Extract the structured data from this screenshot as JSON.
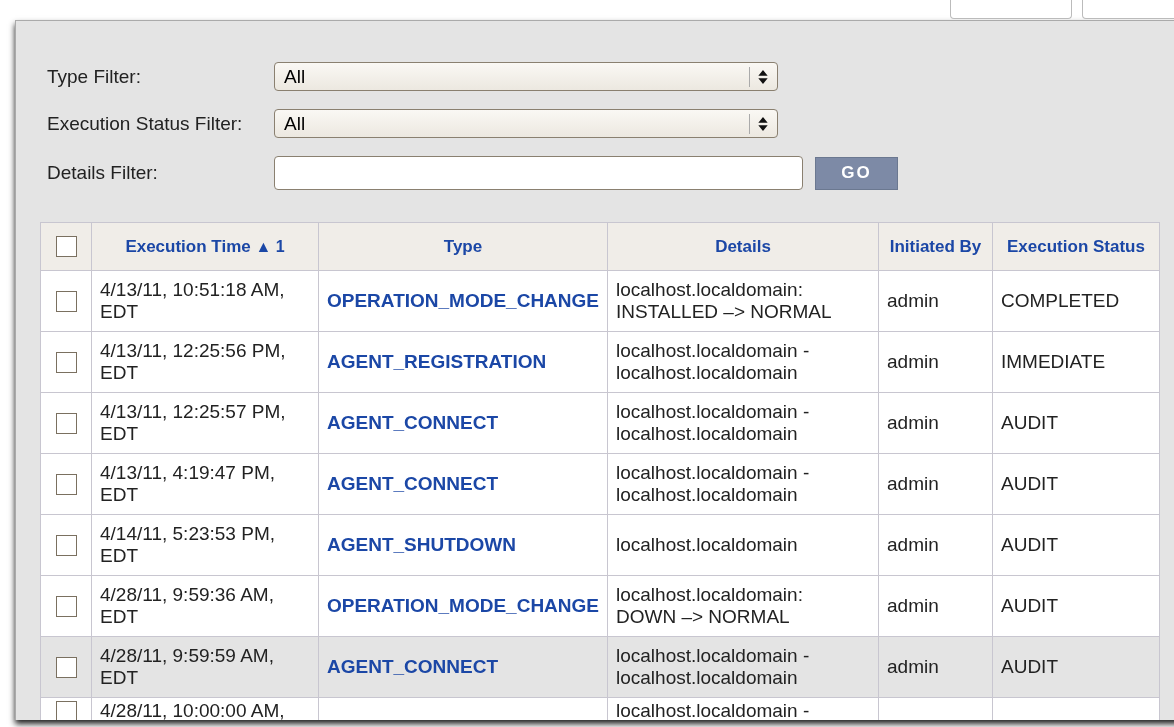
{
  "filters": [
    {
      "kind": "select",
      "label": "Type Filter:",
      "value": "All"
    },
    {
      "kind": "select",
      "label": "Execution Status Filter:",
      "value": "All"
    },
    {
      "kind": "text",
      "label": "Details Filter:",
      "button": "GO"
    }
  ],
  "table": {
    "select_all": {
      "checked": false
    },
    "columns": [
      {
        "label": "Execution Time",
        "sort": "▲ 1"
      },
      {
        "label": "Type"
      },
      {
        "label": "Details"
      },
      {
        "label": "Initiated By"
      },
      {
        "label": "Execution Status"
      }
    ],
    "rows": [
      {
        "checked": false,
        "selected": false,
        "time": "4/13/11, 10:51:18 AM, EDT",
        "type": "OPERATION_MODE_CHANGE",
        "details": "localhost.localdomain: INSTALLED –> NORMAL",
        "initiated_by": "admin",
        "status": "COMPLETED"
      },
      {
        "checked": false,
        "selected": false,
        "time": "4/13/11, 12:25:56 PM, EDT",
        "type": "AGENT_REGISTRATION",
        "details": "localhost.localdomain - localhost.localdomain",
        "initiated_by": "admin",
        "status": "IMMEDIATE"
      },
      {
        "checked": false,
        "selected": false,
        "time": "4/13/11, 12:25:57 PM, EDT",
        "type": "AGENT_CONNECT",
        "details": "localhost.localdomain - localhost.localdomain",
        "initiated_by": "admin",
        "status": "AUDIT"
      },
      {
        "checked": false,
        "selected": false,
        "time": "4/13/11, 4:19:47 PM, EDT",
        "type": "AGENT_CONNECT",
        "details": "localhost.localdomain - localhost.localdomain",
        "initiated_by": "admin",
        "status": "AUDIT"
      },
      {
        "checked": false,
        "selected": false,
        "time": "4/14/11, 5:23:53 PM, EDT",
        "type": "AGENT_SHUTDOWN",
        "details": "localhost.localdomain",
        "initiated_by": "admin",
        "status": "AUDIT"
      },
      {
        "checked": false,
        "selected": false,
        "time": "4/28/11, 9:59:36 AM, EDT",
        "type": "OPERATION_MODE_CHANGE",
        "details": "localhost.localdomain: DOWN –> NORMAL",
        "initiated_by": "admin",
        "status": "AUDIT"
      },
      {
        "checked": false,
        "selected": true,
        "time": "4/28/11, 9:59:59 AM, EDT",
        "type": "AGENT_CONNECT",
        "details": "localhost.localdomain - localhost.localdomain",
        "initiated_by": "admin",
        "status": "AUDIT"
      },
      {
        "checked": false,
        "selected": false,
        "time": "4/28/11, 10:00:00 AM,",
        "details": "localhost.localdomain -"
      }
    ]
  }
}
